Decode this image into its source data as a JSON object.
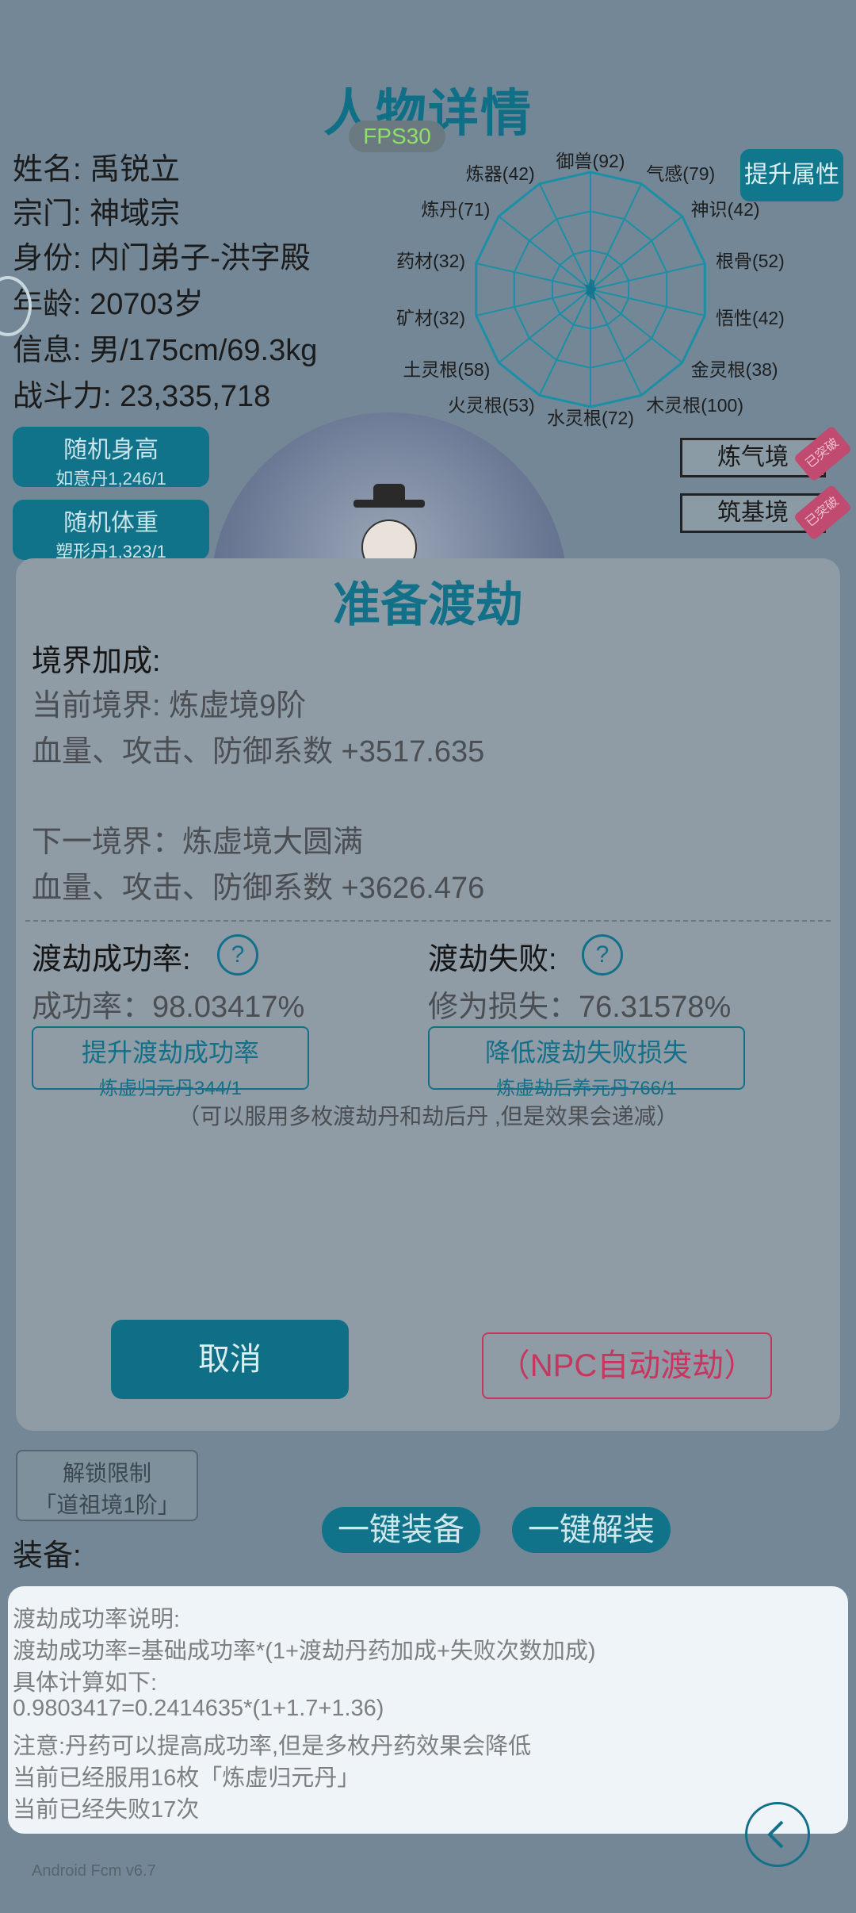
{
  "header": {
    "title": "人物详情",
    "fps": "FPS30",
    "upgrade_label": "提升属性"
  },
  "character": {
    "name": "姓名: 禹锐立",
    "sect": "宗门: 神域宗",
    "identity": "身份: 内门弟子-洪字殿",
    "age": "年龄: 20703岁",
    "info": "信息: 男/175cm/69.3kg",
    "power": "战斗力: 23,335,718"
  },
  "radar": {
    "labels": [
      "御兽(92)",
      "气感(79)",
      "神识(42)",
      "根骨(52)",
      "悟性(42)",
      "金灵根(38)",
      "木灵根(100)",
      "水灵根(72)",
      "火灵根(53)",
      "土灵根(58)",
      "矿材(32)",
      "药材(32)",
      "炼丹(71)",
      "炼器(42)"
    ],
    "values": [
      92,
      79,
      42,
      52,
      42,
      38,
      100,
      72,
      53,
      58,
      32,
      32,
      71,
      42
    ],
    "max": 1000,
    "stroke": "#1a8fa6"
  },
  "random_buttons": [
    {
      "label": "随机身高",
      "sub": "如意丹1,246/1"
    },
    {
      "label": "随机体重",
      "sub": "塑形丹1,323/1"
    }
  ],
  "realm_tabs": [
    {
      "label": "炼气境",
      "badge": "已突破"
    },
    {
      "label": "筑基境",
      "badge": "已突破"
    }
  ],
  "modal": {
    "title": "准备渡劫",
    "bonus_head": "境界加成:",
    "current_realm": "当前境界: 炼虚境9阶",
    "current_bonus": "血量、攻击、防御系数 +3517.635",
    "next_realm": "下一境界：炼虚境大圆满",
    "next_bonus": "血量、攻击、防御系数 +3626.476",
    "success_head": "渡劫成功率:",
    "success_rate": "成功率：98.03417%",
    "fail_head": "渡劫失败:",
    "fail_loss": "修为损失：76.31578%",
    "help_symbol": "?",
    "boost_btn": {
      "label": "提升渡劫成功率",
      "sub": "炼虚归元丹344/1"
    },
    "reduce_btn": {
      "label": "降低渡劫失败损失",
      "sub": "炼虚劫后养元丹766/1"
    },
    "note": "（可以服用多枚渡劫丹和劫后丹 ,但是效果会递减）",
    "cancel": "取消",
    "npc": "（NPC自动渡劫）"
  },
  "lower": {
    "unlock": {
      "line1": "解锁限制",
      "line2": "「道祖境1阶」"
    },
    "equip_all": "一键装备",
    "unequip_all": "一键解装",
    "equipment_head": "装备:"
  },
  "tooltip": {
    "lines": [
      "渡劫成功率说明:",
      "渡劫成功率=基础成功率*(1+渡劫丹药加成+失败次数加成)",
      "具体计算如下:",
      "0.9803417=0.2414635*(1+1.7+1.36)",
      "注意:丹药可以提高成功率,但是多枚丹药效果会降低",
      "当前已经服用16枚「炼虚归元丹」",
      "当前已经失败17次"
    ]
  },
  "footer": {
    "version": "Android Fcm v6.7"
  }
}
